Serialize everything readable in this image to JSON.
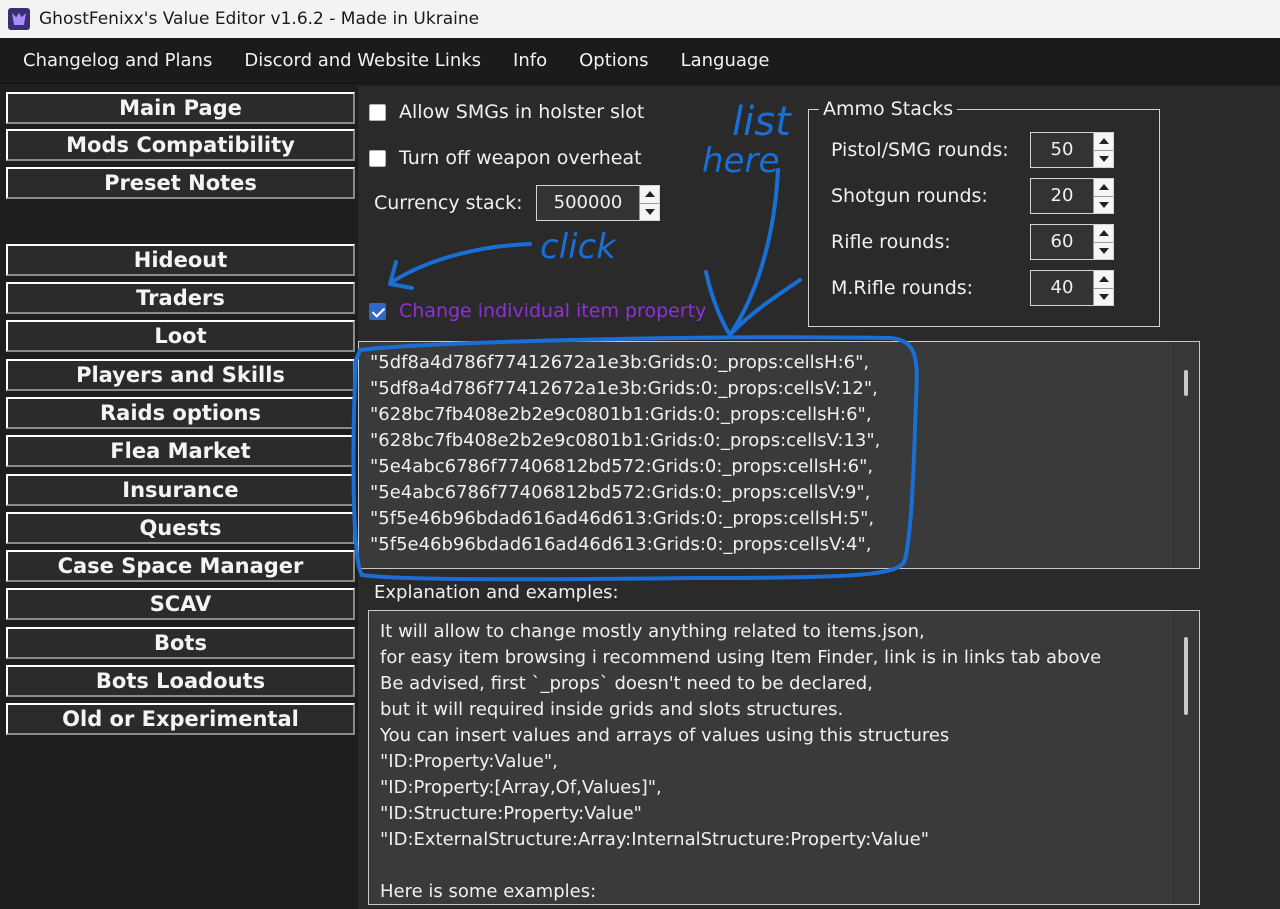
{
  "window": {
    "title": "GhostFenixx's Value Editor v1.6.2 - Made in Ukraine"
  },
  "menu": {
    "items": [
      "Changelog and Plans",
      "Discord and Website Links",
      "Info",
      "Options",
      "Language"
    ]
  },
  "sidebar": {
    "items": [
      "Main Page",
      "Mods Compatibility",
      "Preset Notes",
      "Hideout",
      "Traders",
      "Loot",
      "Players and Skills",
      "Raids options",
      "Flea Market",
      "Insurance",
      "Quests",
      "Case Space Manager",
      "SCAV",
      "Bots",
      "Bots Loadouts",
      "Old or Experimental"
    ]
  },
  "options": {
    "allow_smgs": {
      "label": "Allow SMGs in holster slot",
      "checked": false
    },
    "overheat": {
      "label": "Turn off weapon overheat",
      "checked": false
    },
    "currency": {
      "label": "Currency stack:",
      "value": "500000"
    },
    "individual": {
      "label": "Change individual item property",
      "checked": true
    }
  },
  "ammo": {
    "title": "Ammo Stacks",
    "rows": [
      {
        "label": "Pistol/SMG rounds:",
        "value": "50"
      },
      {
        "label": "Shotgun rounds:",
        "value": "20"
      },
      {
        "label": "Rifle rounds:",
        "value": "60"
      },
      {
        "label": "M.Rifle rounds:",
        "value": "40"
      }
    ]
  },
  "property_list": {
    "lines": [
      "\"5df8a4d786f77412672a1e3b:Grids:0:_props:cellsH:6\",",
      "\"5df8a4d786f77412672a1e3b:Grids:0:_props:cellsV:12\",",
      "\"628bc7fb408e2b2e9c0801b1:Grids:0:_props:cellsH:6\",",
      "\"628bc7fb408e2b2e9c0801b1:Grids:0:_props:cellsV:13\",",
      "\"5e4abc6786f77406812bd572:Grids:0:_props:cellsH:6\",",
      "\"5e4abc6786f77406812bd572:Grids:0:_props:cellsV:9\",",
      "\"5f5e46b96bdad616ad46d613:Grids:0:_props:cellsH:5\",",
      "\"5f5e46b96bdad616ad46d613:Grids:0:_props:cellsV:4\","
    ]
  },
  "explanation": {
    "label": "Explanation and examples:",
    "lines": [
      "It will allow to change mostly anything related to items.json,",
      "for easy item browsing i recommend using Item Finder, link is in links tab above",
      "Be advised, first `_props` doesn't need to be declared,",
      "but it will required inside grids and slots structures.",
      "You can insert values and arrays of values using this structures",
      "\"ID:Property:Value\",",
      "\"ID:Property:[Array,Of,Values]\",",
      "\"ID:Structure:Property:Value\"",
      "\"ID:ExternalStructure:Array:InternalStructure:Property:Value\"",
      "",
      "Here is some examples:"
    ]
  },
  "annotations": {
    "list_note": "list",
    "here_note": "here",
    "click_note": "click",
    "ink_color": "#1a6fd6"
  }
}
